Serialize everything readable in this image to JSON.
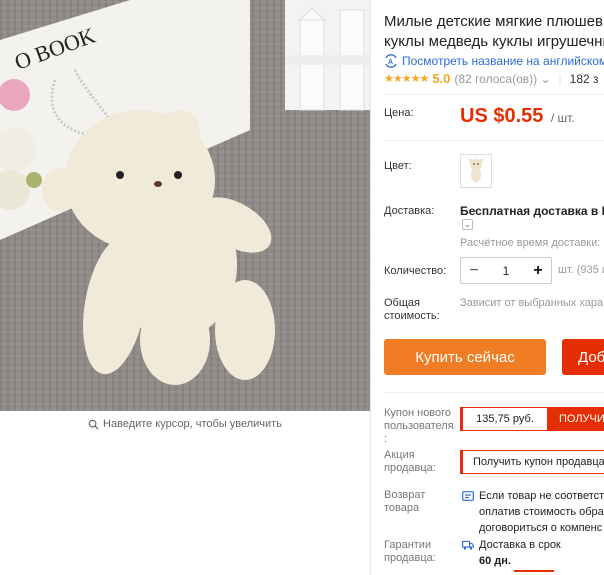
{
  "product": {
    "title_line1": "Милые детские мягкие плюшевые",
    "title_line2": "куклы медведь куклы игрушечные",
    "translate_link": "Посмотреть название на английском",
    "rating_value": "5.0",
    "rating_count": "(82 голоса(ов)) ⌄",
    "sold": "182 з"
  },
  "gallery": {
    "zoom_hint": "Наведите курсор, чтобы увеличить",
    "book_text": "O BOOK"
  },
  "price": {
    "label": "Цена:",
    "value": "US $0.55",
    "unit": "/ шт."
  },
  "color": {
    "label": "Цвет:"
  },
  "shipping": {
    "label": "Доставка:",
    "main": "Бесплатная доставка в Rus",
    "estimate": "Расчётное время доставки:"
  },
  "quantity": {
    "label": "Количество:",
    "minus": "−",
    "value": "1",
    "plus": "+",
    "available": "шт. (935 и"
  },
  "total": {
    "label_line1": "Общая",
    "label_line2": "стоимость:",
    "text": "Зависит от выбранных хара"
  },
  "actions": {
    "buy_now": "Купить сейчас",
    "add_to_cart": "Доб"
  },
  "coupons": {
    "new_user_label_1": "Купон нового",
    "new_user_label_2": "пользователя",
    "new_user_label_3": ":",
    "new_user_value": "135,75 руб.",
    "new_user_get": "ПОЛУЧИ",
    "seller_label_1": "Акция",
    "seller_label_2": "продавца:",
    "seller_get": "Получить купон продавца"
  },
  "returns": {
    "label_1": "Возврат",
    "label_2": "товара",
    "line1": "Если товар не соответст",
    "line2": "оплатив стоимость обра",
    "line3": "договориться о компенс"
  },
  "guarantee": {
    "label_1": "Гарантии",
    "label_2": "продавца:",
    "line1": "Доставка в срок",
    "line2": "60 дн."
  },
  "colors": {
    "accent": "#e62e04",
    "buy": "#f07c23",
    "link": "#2f6bd5",
    "star": "#f5a623"
  }
}
